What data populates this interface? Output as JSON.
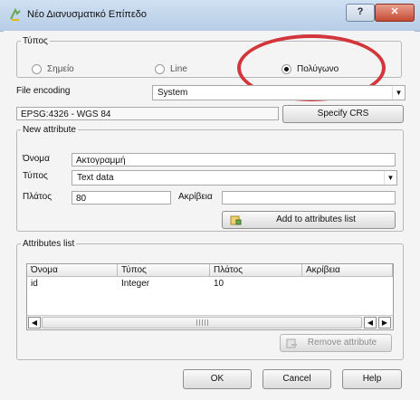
{
  "window": {
    "title": "Νέο Διανυσματικό Επίπεδο",
    "help_glyph": "?",
    "close_glyph": "✕"
  },
  "type_group": {
    "legend": "Τύπος",
    "options": [
      {
        "label": "Σημείο",
        "selected": false
      },
      {
        "label": "Line",
        "selected": false
      },
      {
        "label": "Πολύγωνο",
        "selected": true
      }
    ]
  },
  "file_encoding": {
    "label": "File encoding",
    "value": "System"
  },
  "crs": {
    "value": "EPSG:4326 - WGS 84",
    "button": "Specify CRS"
  },
  "new_attribute": {
    "legend": "New attribute",
    "name_label": "Όνομα",
    "name_value": "Ακτογραμμή",
    "type_label": "Τύπος",
    "type_value": "Text data",
    "width_label": "Πλάτος",
    "width_value": "80",
    "precision_label": "Ακρίβεια",
    "precision_value": "",
    "add_button": "Add to attributes list"
  },
  "attributes_list": {
    "legend": "Attributes list",
    "columns": [
      "Όνομα",
      "Τύπος",
      "Πλάτος",
      "Ακρίβεια"
    ],
    "rows": [
      [
        "id",
        "Integer",
        "10",
        ""
      ]
    ],
    "remove_button": "Remove attribute"
  },
  "footer": {
    "ok": "OK",
    "cancel": "Cancel",
    "help": "Help"
  },
  "colors": {
    "highlight": "#d2363a",
    "titlebar": "#c3d7ee"
  },
  "icons": [
    "qgis-logo-icon",
    "add-attribute-icon",
    "remove-attribute-icon"
  ]
}
